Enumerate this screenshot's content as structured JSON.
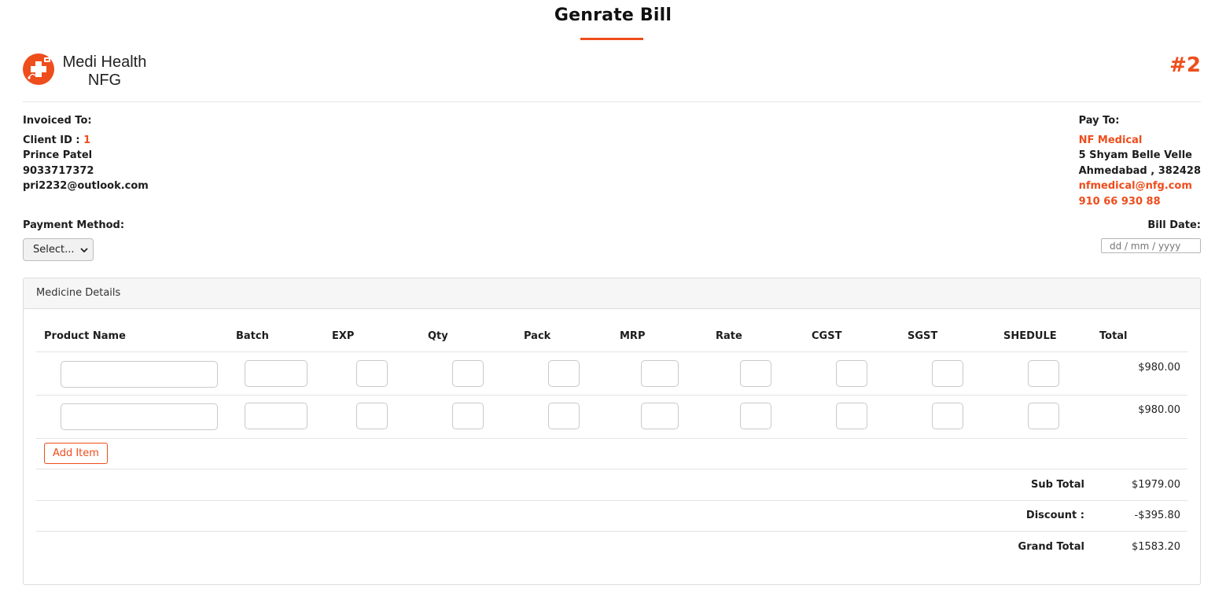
{
  "page": {
    "title": "Genrate Bill",
    "invoice_number": "#2"
  },
  "brand": {
    "name_line1": "Medi Health",
    "name_line2": "NFG",
    "accent_color": "#ee4d1c"
  },
  "invoiced_to": {
    "heading": "Invoiced To:",
    "client_id_label": "Client ID : ",
    "client_id": "1",
    "name": "Prince Patel",
    "phone": "9033717372",
    "email": "pri2232@outlook.com"
  },
  "pay_to": {
    "heading": "Pay To:",
    "name": "NF Medical",
    "address_line1": "5 Shyam Belle Velle",
    "address_line2": "Ahmedabad , 382428",
    "email": "nfmedical@nfg.com",
    "phone": "910 66 930 88"
  },
  "payment": {
    "label": "Payment Method:",
    "selected": "Select..."
  },
  "bill_date": {
    "label": "Bill Date:",
    "placeholder": "dd / mm / yyyy"
  },
  "medicine": {
    "card_title": "Medicine Details",
    "columns": [
      "Product Name",
      "Batch",
      "EXP",
      "Qty",
      "Pack",
      "MRP",
      "Rate",
      "CGST",
      "SGST",
      "SHEDULE",
      "Total"
    ],
    "rows": [
      {
        "total": "$980.00"
      },
      {
        "total": "$980.00"
      }
    ],
    "add_item_label": "Add Item"
  },
  "summary": {
    "subtotal_label": "Sub Total",
    "subtotal_value": "$1979.00",
    "discount_label": "Discount :",
    "discount_value": "-$395.80",
    "grand_total_label": "Grand Total",
    "grand_total_value": "$1583.20"
  }
}
